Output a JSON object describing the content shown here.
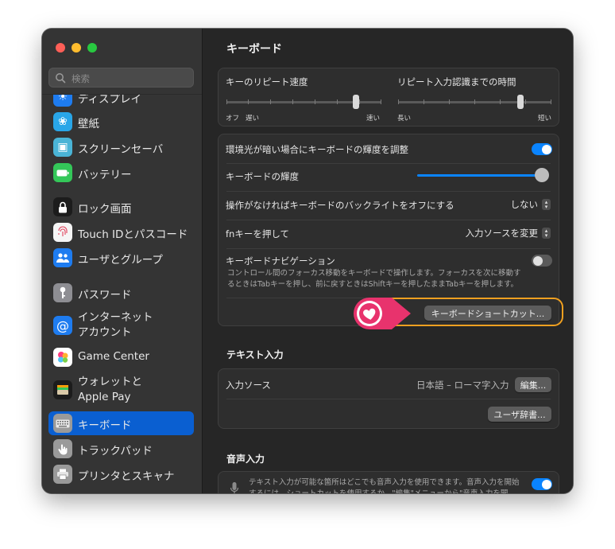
{
  "sidebar": {
    "search_placeholder": "検索",
    "items": [
      {
        "label": "ディスプレイ",
        "icon": "display-icon"
      },
      {
        "label": "壁紙",
        "icon": "wallpaper-icon"
      },
      {
        "label": "スクリーンセーバ",
        "icon": "screensaver-icon"
      },
      {
        "label": "バッテリー",
        "icon": "battery-icon"
      },
      {
        "label": "ロック画面",
        "icon": "lock-icon"
      },
      {
        "label": "Touch IDとパスコード",
        "icon": "fingerprint-icon"
      },
      {
        "label": "ユーザとグループ",
        "icon": "users-icon"
      },
      {
        "label": "パスワード",
        "icon": "key-icon"
      },
      {
        "label": "インターネット\nアカウント",
        "icon": "at-icon"
      },
      {
        "label": "Game Center",
        "icon": "game-center-icon"
      },
      {
        "label": "ウォレットと\nApple Pay",
        "icon": "wallet-icon"
      },
      {
        "label": "キーボード",
        "icon": "keyboard-icon",
        "selected": true
      },
      {
        "label": "トラックパッド",
        "icon": "trackpad-icon"
      },
      {
        "label": "プリンタとスキャナ",
        "icon": "printer-icon"
      }
    ]
  },
  "main": {
    "title": "キーボード",
    "repeat": {
      "key_repeat_label": "キーのリピート速度",
      "delay_label": "リピート入力認識までの時間",
      "key_repeat_left1": "オフ",
      "key_repeat_left2": "遅い",
      "key_repeat_right": "速い",
      "delay_left": "長い",
      "delay_right": "短い",
      "key_repeat_level": 0.86,
      "delay_level": 0.83
    },
    "settings": {
      "ambient_label": "環境光が暗い場合にキーボードの輝度を調整",
      "ambient_on": true,
      "brightness_label": "キーボードの輝度",
      "brightness_level": 1.0,
      "backlight_label": "操作がなければキーボードのバックライトをオフにする",
      "backlight_value": "しない",
      "fn_label": "fnキーを押して",
      "fn_value": "入力ソースを変更",
      "nav_label": "キーボードナビゲーション",
      "nav_on": false,
      "nav_desc": "コントロール間のフォーカス移動をキーボードで操作します。フォーカスを次に移動するときはTabキーを押し、前に戻すときはShiftキーを押したままTabキーを押します。",
      "shortcuts_button": "キーボードショートカット..."
    },
    "text_input": {
      "section_title": "テキスト入力",
      "input_sources_label": "入力ソース",
      "input_sources_value": "日本語 – ローマ字入力",
      "edit_button": "編集...",
      "user_dict_button": "ユーザ辞書..."
    },
    "dictation": {
      "section_title": "音声入力",
      "desc": "テキスト入力が可能な箇所はどこでも音声入力を使用できます。音声入力を開始するには、ショートカットを使用するか、\"編集\"メニューから\"音声入力を開始\"を選択します。",
      "on": true
    }
  },
  "colors": {
    "accent": "#0a84ff",
    "sidebar_selected": "#0a5fd1",
    "highlight_ring": "#f0a020",
    "marker": "#e8336d"
  }
}
